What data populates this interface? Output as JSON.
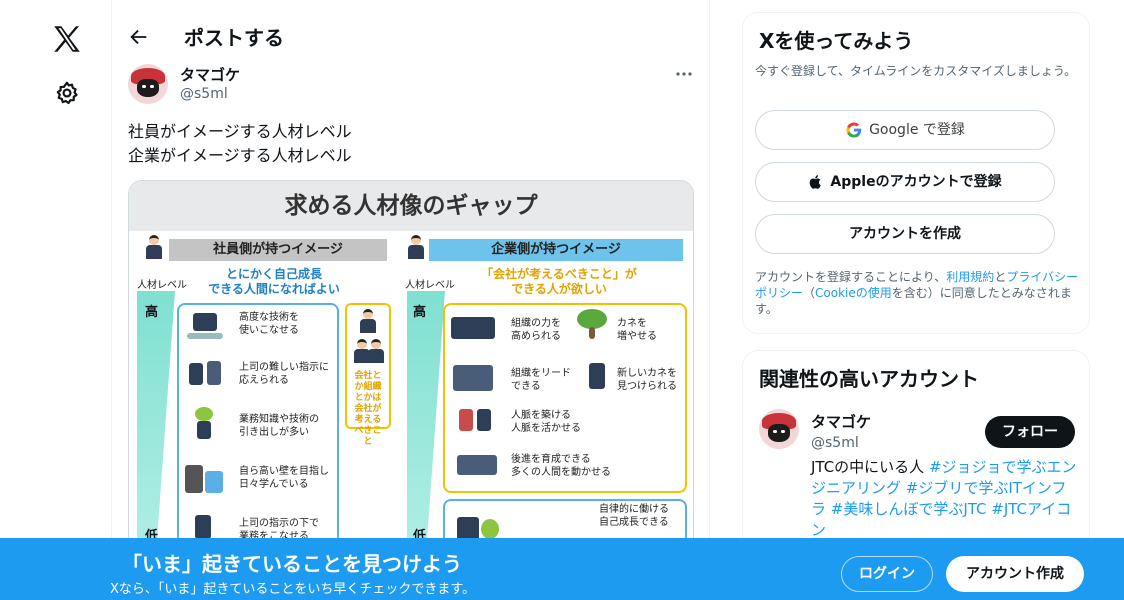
{
  "nav": {
    "logo_icon": "x-logo-icon",
    "settings_icon": "gear-icon"
  },
  "header": {
    "title": "ポストする",
    "back_icon": "arrow-left-icon"
  },
  "post": {
    "author_name": "タマゴケ",
    "author_handle": "@s5ml",
    "text_line1": "社員がイメージする人材レベル",
    "text_line2": "企業がイメージする人材レベル",
    "more_icon": "more-horizontal-icon"
  },
  "infographic": {
    "title": "求める人材像のギャップ",
    "left_header": "社員側が持つイメージ",
    "right_header": "企業側が持つイメージ",
    "level_label": "人材レベル",
    "high": "高",
    "low": "低",
    "left_sub": "とにかく自己成長\nできる人間になればよい",
    "right_sub": "「会社が考えるべきこと」が\nできる人が欲しい",
    "yellow_note": "会社とか組織とかは会社が考えるべきこと",
    "left_items": [
      "高度な技術を\n使いこなせる",
      "上司の難しい指示に\n応えられる",
      "業務知識や技術の\n引き出しが多い",
      "自ら高い壁を目指し\n日々学んでいる",
      "上司の指示の下で\n業務をこなせる"
    ],
    "right_items": [
      "組織の力を\n高められる",
      "カネを\n増やせる",
      "組織をリード\nできる",
      "新しいカネを\n見つけられる",
      "人脈を築ける\n人脈を活かせる",
      "後進を育成できる\n多くの人間を動かせる",
      "自律的に働ける\n自己成長できる"
    ]
  },
  "signup_card": {
    "title": "Xを使ってみよう",
    "subtitle": "今すぐ登録して、タイムラインをカスタマイズしましょう。",
    "google_label": "Google で登録",
    "apple_label": "Appleのアカウントで登録",
    "create_label": "アカウントを作成",
    "terms_prefix": "アカウントを登録することにより、",
    "terms_link": "利用規約",
    "terms_and": "と",
    "privacy_link": "プライバシーポリシー",
    "cookie_open": "（",
    "cookie_link": "Cookieの使用",
    "terms_suffix": "を含む）に同意したとみなされます。"
  },
  "related": {
    "title": "関連性の高いアカウント",
    "name": "タマゴケ",
    "handle": "@s5ml",
    "follow_label": "フォロー",
    "bio_text": "JTCの中にいる人 ",
    "bio_tags": "#ジョジョで学ぶエンジニアリング #ジブリで学ぶITインフラ #美味しんぼで学ぶJTC #JTCアイコン"
  },
  "banner": {
    "title": "「いま」起きていることを見つけよう",
    "subtitle": "Xなら、「いま」起きていることをいち早くチェックできます。",
    "login_label": "ログイン",
    "signup_label": "アカウント作成"
  },
  "colors": {
    "accent": "#1d9bf0",
    "text": "#0f1419",
    "muted": "#536471"
  }
}
